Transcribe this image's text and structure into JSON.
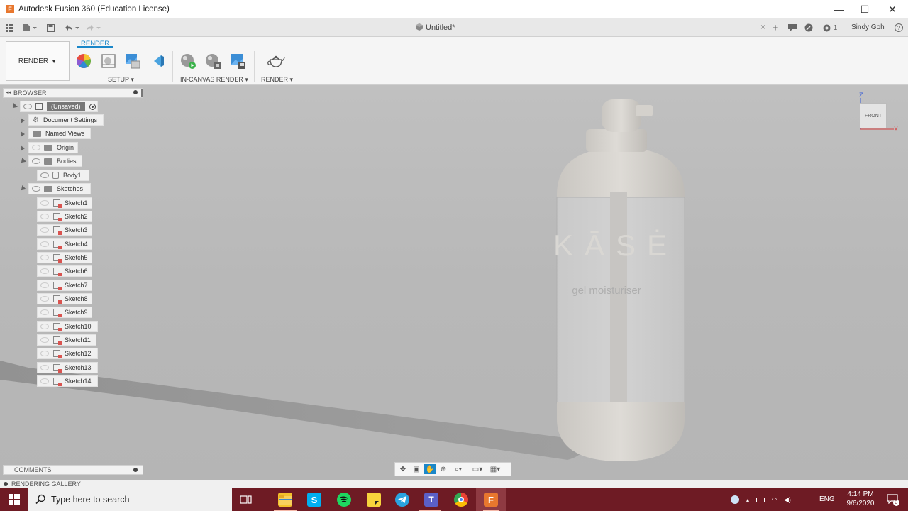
{
  "window": {
    "title": "Autodesk Fusion 360 (Education License)",
    "app_icon_letter": "F",
    "minimize": "—",
    "maximize": "☐",
    "close": "✕"
  },
  "quick_access": {
    "document_title": "Untitled*",
    "tab_close": "×",
    "plus": "+",
    "job_count": "1",
    "user": "Sindy Goh",
    "help": "?"
  },
  "ribbon": {
    "workspace": "RENDER",
    "active_tab": "RENDER",
    "groups": [
      {
        "label": "SETUP"
      },
      {
        "label": "IN-CANVAS RENDER"
      },
      {
        "label": "RENDER"
      }
    ]
  },
  "browser": {
    "header": "BROWSER",
    "root": "(Unsaved)",
    "items": [
      {
        "label": "Document Settings"
      },
      {
        "label": "Named Views"
      },
      {
        "label": "Origin"
      },
      {
        "label": "Bodies"
      },
      {
        "label": "Body1"
      },
      {
        "label": "Sketches"
      }
    ],
    "sketches": [
      "Sketch1",
      "Sketch2",
      "Sketch3",
      "Sketch4",
      "Sketch5",
      "Sketch6",
      "Sketch7",
      "Sketch8",
      "Sketch9",
      "Sketch10",
      "Sketch11",
      "Sketch12",
      "Sketch13",
      "Sketch14"
    ]
  },
  "model": {
    "brand_text": "KĀSĖ",
    "sub_text": "gel moisturiser"
  },
  "viewcube": {
    "face": "FRONT",
    "z": "Z",
    "x": "X"
  },
  "comments": {
    "header": "COMMENTS"
  },
  "gallery": {
    "label": "RENDERING GALLERY"
  },
  "taskbar": {
    "search_placeholder": "Type here to search",
    "language": "ENG",
    "time": "4:14 PM",
    "date": "9/6/2020",
    "notification_count": "3"
  },
  "colors": {
    "accent": "#1a87c9",
    "taskbar": "#6e1b24",
    "canvas": "#bdbdbd",
    "bottle": "#d7d5d1"
  }
}
